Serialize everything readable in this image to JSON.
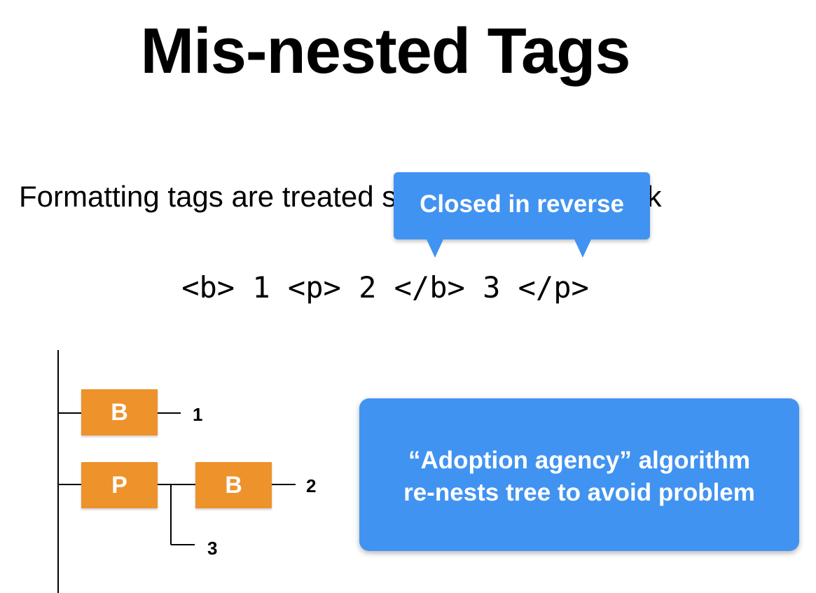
{
  "slide": {
    "title": "Mis-nested Tags",
    "subtitle": "Formatting tags are treated specially on the stack",
    "code": "<b> 1 <p> 2 </b> 3 </p>",
    "callout": "Closed in reverse",
    "tree": {
      "nodes": [
        {
          "label": "B"
        },
        {
          "label": "P"
        },
        {
          "label": "B"
        }
      ],
      "leaves": [
        "1",
        "2",
        "3"
      ]
    },
    "note": {
      "line1": "“Adoption agency” algorithm",
      "line2": "re-nests tree to avoid problem"
    },
    "colors": {
      "accent_blue": "#4193f1",
      "node_orange": "#ee922c"
    }
  }
}
